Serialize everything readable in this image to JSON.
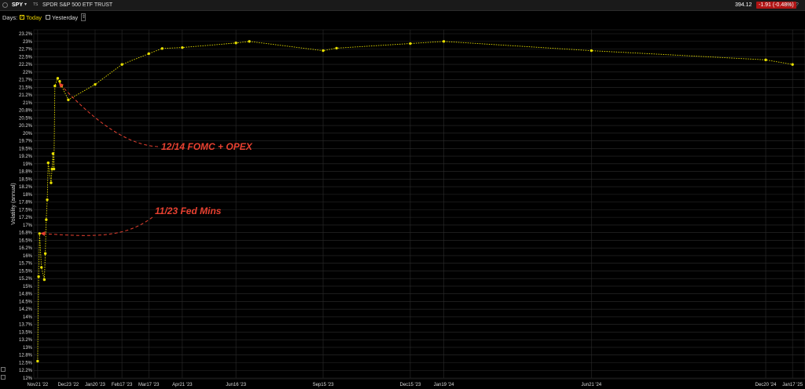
{
  "header": {
    "symbol": "SPY",
    "caret": "▾",
    "ts": "TS",
    "name": "SPDR S&P 500 ETF TRUST",
    "price": "394.12",
    "change": "-1.91  (-0.48%)",
    "change_color": "#b01414"
  },
  "toolbar": {
    "days_label": "Days:",
    "today_label": "Today",
    "today_checked": true,
    "yesterday_label": "Yesterday",
    "yesterday_checked": false
  },
  "icons": {
    "menu": "circle-menu-icon",
    "settings": "gear-icon",
    "help": "help-icon",
    "pin": "pin-icon"
  },
  "chart_data": {
    "type": "line",
    "ylabel": "Volatility (annual)",
    "y_tick_labels": [
      "12%",
      "12.2%",
      "12.5%",
      "12.8%",
      "13%",
      "13.2%",
      "13.5%",
      "13.7%",
      "14%",
      "14.2%",
      "14.5%",
      "14.8%",
      "15%",
      "15.2%",
      "15.5%",
      "15.7%",
      "16%",
      "16.2%",
      "16.5%",
      "16.8%",
      "17%",
      "17.2%",
      "17.5%",
      "17.8%",
      "18%",
      "18.2%",
      "18.5%",
      "18.8%",
      "19%",
      "19.2%",
      "19.5%",
      "19.7%",
      "20%",
      "20.2%",
      "20.5%",
      "20.8%",
      "21%",
      "21.2%",
      "21.5%",
      "21.7%",
      "22%",
      "22.2%",
      "22.5%",
      "22.7%",
      "23%",
      "23.2%"
    ],
    "ylim": [
      12,
      23.2
    ],
    "x_ticks": [
      {
        "label": "Nov21 '22",
        "date": "2022-11-21"
      },
      {
        "label": "Dec23 '22",
        "date": "2022-12-23"
      },
      {
        "label": "Jan20 '23",
        "date": "2023-01-20"
      },
      {
        "label": "Feb17 '23",
        "date": "2023-02-17"
      },
      {
        "label": "Mar17 '23",
        "date": "2023-03-17"
      },
      {
        "label": "Apr21 '23",
        "date": "2023-04-21"
      },
      {
        "label": "Jun16 '23",
        "date": "2023-06-16"
      },
      {
        "label": "Sep15 '23",
        "date": "2023-09-15"
      },
      {
        "label": "Dec15 '23",
        "date": "2023-12-15"
      },
      {
        "label": "Jan19 '24",
        "date": "2024-01-19"
      },
      {
        "label": "Jun21 '24",
        "date": "2024-06-21"
      },
      {
        "label": "Dec20 '24",
        "date": "2024-12-20"
      },
      {
        "label": "Jan17 '25",
        "date": "2025-01-17"
      }
    ],
    "xlim": [
      "2022-11-17",
      "2025-01-30"
    ],
    "series": [
      {
        "color": "#e8e000",
        "points": [
          {
            "x": "2022-11-21",
            "y": 12.55
          },
          {
            "x": "2022-11-22",
            "y": 15.3
          },
          {
            "x": "2022-11-23",
            "y": 16.7
          },
          {
            "x": "2022-11-25",
            "y": 15.6
          },
          {
            "x": "2022-11-28",
            "y": 15.2
          },
          {
            "x": "2022-11-29",
            "y": 16.05
          },
          {
            "x": "2022-11-30",
            "y": 17.15
          },
          {
            "x": "2022-12-01",
            "y": 17.8
          },
          {
            "x": "2022-12-02",
            "y": 19.0
          },
          {
            "x": "2022-12-05",
            "y": 18.35
          },
          {
            "x": "2022-12-06",
            "y": 18.8
          },
          {
            "x": "2022-12-07",
            "y": 19.3
          },
          {
            "x": "2022-12-08",
            "y": 18.8
          },
          {
            "x": "2022-12-09",
            "y": 21.5
          },
          {
            "x": "2022-12-12",
            "y": 21.75
          },
          {
            "x": "2022-12-14",
            "y": 21.65
          },
          {
            "x": "2022-12-16",
            "y": 21.5
          },
          {
            "x": "2022-12-23",
            "y": 21.05
          },
          {
            "x": "2023-01-20",
            "y": 21.55
          },
          {
            "x": "2023-02-17",
            "y": 22.2
          },
          {
            "x": "2023-03-17",
            "y": 22.55
          },
          {
            "x": "2023-03-31",
            "y": 22.72
          },
          {
            "x": "2023-04-21",
            "y": 22.75
          },
          {
            "x": "2023-06-16",
            "y": 22.9
          },
          {
            "x": "2023-06-30",
            "y": 22.95
          },
          {
            "x": "2023-09-15",
            "y": 22.65
          },
          {
            "x": "2023-09-29",
            "y": 22.73
          },
          {
            "x": "2023-12-15",
            "y": 22.88
          },
          {
            "x": "2024-01-19",
            "y": 22.95
          },
          {
            "x": "2024-06-21",
            "y": 22.65
          },
          {
            "x": "2024-12-20",
            "y": 22.35
          },
          {
            "x": "2025-01-17",
            "y": 22.2
          }
        ]
      }
    ],
    "annotations": [
      {
        "text": "12/14 FOMC + OPEX",
        "arrow_to": {
          "x": "2022-12-14",
          "y": 21.65
        },
        "color": "#e84030"
      },
      {
        "text": "11/23 Fed Mins",
        "arrow_to": {
          "x": "2022-11-23",
          "y": 16.7
        },
        "color": "#e84030"
      }
    ],
    "grid": true,
    "legend": "none"
  }
}
